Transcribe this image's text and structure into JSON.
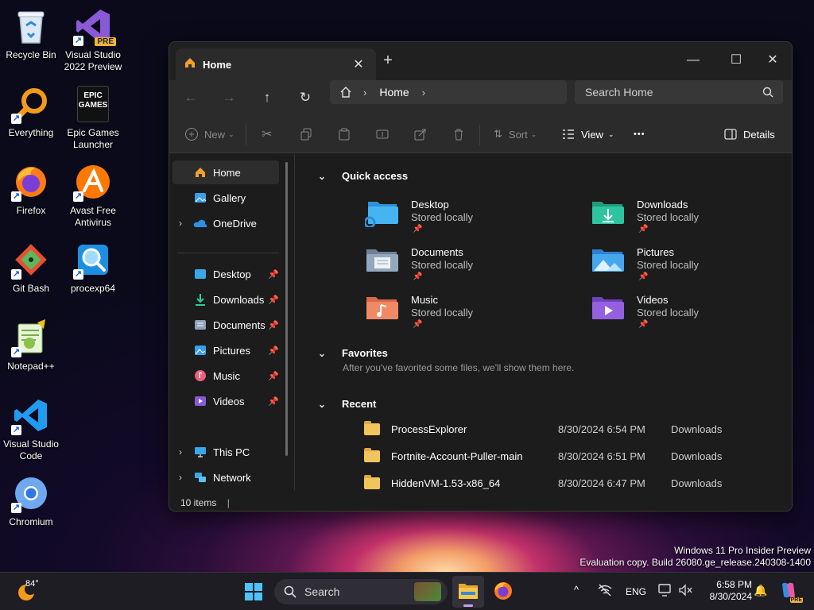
{
  "desktop": {
    "icons": [
      {
        "label": "Recycle Bin"
      },
      {
        "label": "Visual Studio 2022 Preview",
        "badge": "PRE"
      },
      {
        "label": "Everything"
      },
      {
        "label": "Epic Games Launcher",
        "logo_text": "EPIC GAMES"
      },
      {
        "label": "Firefox"
      },
      {
        "label": "Avast Free Antivirus"
      },
      {
        "label": "Git Bash"
      },
      {
        "label": "procexp64"
      },
      {
        "label": "Notepad++"
      },
      {
        "label": "Visual Studio Code"
      },
      {
        "label": "Chromium"
      }
    ]
  },
  "window": {
    "tab_title": "Home",
    "address": {
      "segment": "Home"
    },
    "search_placeholder": "Search Home",
    "toolbar": {
      "new_label": "New",
      "sort_label": "Sort",
      "view_label": "View",
      "more_label": "•••",
      "details_label": "Details"
    },
    "sidebar": {
      "items": [
        {
          "label": "Home"
        },
        {
          "label": "Gallery"
        },
        {
          "label": "OneDrive"
        },
        {
          "label": "Desktop"
        },
        {
          "label": "Downloads"
        },
        {
          "label": "Documents"
        },
        {
          "label": "Pictures"
        },
        {
          "label": "Music"
        },
        {
          "label": "Videos"
        },
        {
          "label": "This PC"
        },
        {
          "label": "Network"
        }
      ]
    },
    "quick_access": {
      "title": "Quick access",
      "items": [
        {
          "name": "Desktop",
          "sub": "Stored locally"
        },
        {
          "name": "Downloads",
          "sub": "Stored locally"
        },
        {
          "name": "Documents",
          "sub": "Stored locally"
        },
        {
          "name": "Pictures",
          "sub": "Stored locally"
        },
        {
          "name": "Music",
          "sub": "Stored locally"
        },
        {
          "name": "Videos",
          "sub": "Stored locally"
        }
      ]
    },
    "favorites": {
      "title": "Favorites",
      "empty_text": "After you've favorited some files, we'll show them here."
    },
    "recent": {
      "title": "Recent",
      "rows": [
        {
          "name": "ProcessExplorer",
          "date": "8/30/2024 6:54 PM",
          "location": "Downloads"
        },
        {
          "name": "Fortnite-Account-Puller-main",
          "date": "8/30/2024 6:51 PM",
          "location": "Downloads"
        },
        {
          "name": "HiddenVM-1.53-x86_64",
          "date": "8/30/2024 6:47 PM",
          "location": "Downloads"
        }
      ]
    },
    "status": "10 items"
  },
  "watermark": {
    "line1": "Windows 11 Pro Insider Preview",
    "line2": "Evaluation copy. Build 26080.ge_release.240308-1400"
  },
  "taskbar": {
    "weather_temp": "84°",
    "search_label": "Search",
    "language": "ENG",
    "time": "6:58 PM",
    "date": "8/30/2024",
    "copilot_badge": "PRE"
  }
}
